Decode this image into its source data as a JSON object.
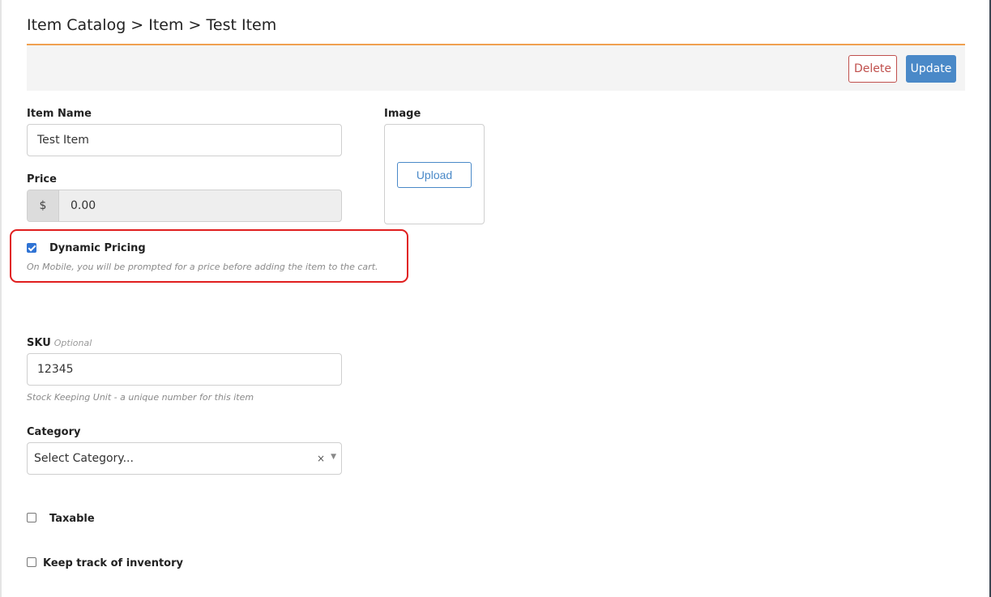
{
  "breadcrumb": "Item Catalog > Item > Test Item",
  "toolbar": {
    "delete_label": "Delete",
    "update_label": "Update"
  },
  "item_name": {
    "label": "Item Name",
    "value": "Test Item"
  },
  "price": {
    "label": "Price",
    "currency_symbol": "$",
    "value": "0.00"
  },
  "image": {
    "label": "Image",
    "upload_label": "Upload"
  },
  "dynamic_pricing": {
    "label": "Dynamic Pricing",
    "checked": true,
    "help": "On Mobile, you will be prompted for a price before adding the item to the cart."
  },
  "sku": {
    "label": "SKU",
    "optional_label": "Optional",
    "value": "12345",
    "help": "Stock Keeping Unit - a unique number for this item"
  },
  "category": {
    "label": "Category",
    "placeholder": "Select Category...",
    "clear_icon": "×",
    "caret_icon": "▼"
  },
  "taxable": {
    "label": "Taxable",
    "checked": false
  },
  "inventory": {
    "label": "Keep track of inventory",
    "checked": false
  },
  "colors": {
    "accent": "#4a89c8",
    "danger": "#c0504d",
    "rule": "#f0a050",
    "highlight": "#e01e1e"
  }
}
